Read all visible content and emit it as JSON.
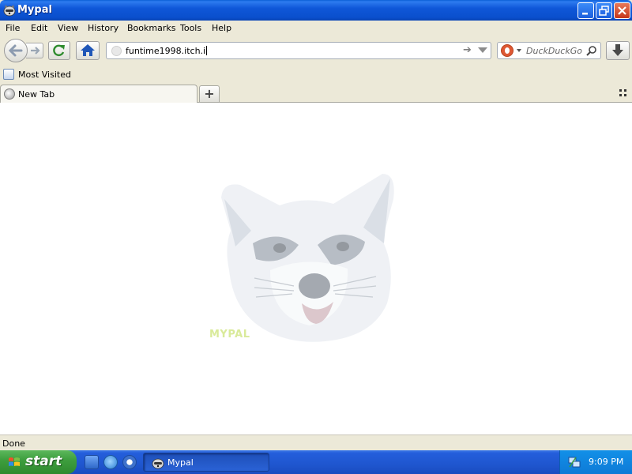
{
  "window": {
    "title": "Mypal"
  },
  "menu": {
    "items": [
      {
        "label": "File",
        "name": "menu-file"
      },
      {
        "label": "Edit",
        "name": "menu-edit"
      },
      {
        "label": "View",
        "name": "menu-view"
      },
      {
        "label": "History",
        "name": "menu-history"
      },
      {
        "label": "Bookmarks",
        "name": "menu-bookmarks"
      },
      {
        "label": "Tools",
        "name": "menu-tools"
      },
      {
        "label": "Help",
        "name": "menu-help"
      }
    ]
  },
  "navbar": {
    "url": "funtime1998.itch.i",
    "search_placeholder": "DuckDuckGo"
  },
  "bookmarks": {
    "most_visited": "Most Visited"
  },
  "tabs": [
    {
      "label": "New Tab"
    }
  ],
  "content": {
    "watermark": "MYPAL"
  },
  "status": {
    "text": "Done"
  },
  "taskbar": {
    "start_label": "start",
    "task_label": "Mypal",
    "clock": "9:09 PM"
  },
  "icons": {
    "app": "raccoon-icon",
    "back": "back-arrow-icon",
    "forward": "forward-arrow-icon",
    "reload": "reload-icon",
    "home": "home-icon",
    "download": "download-icon",
    "search": "magnifier-icon",
    "search_engine": "duckduckgo-icon"
  },
  "colors": {
    "titlebar": "#0A4FCD",
    "taskbar": "#245EDB",
    "start": "#3E9E3E",
    "chrome": "#ECE9D8"
  }
}
